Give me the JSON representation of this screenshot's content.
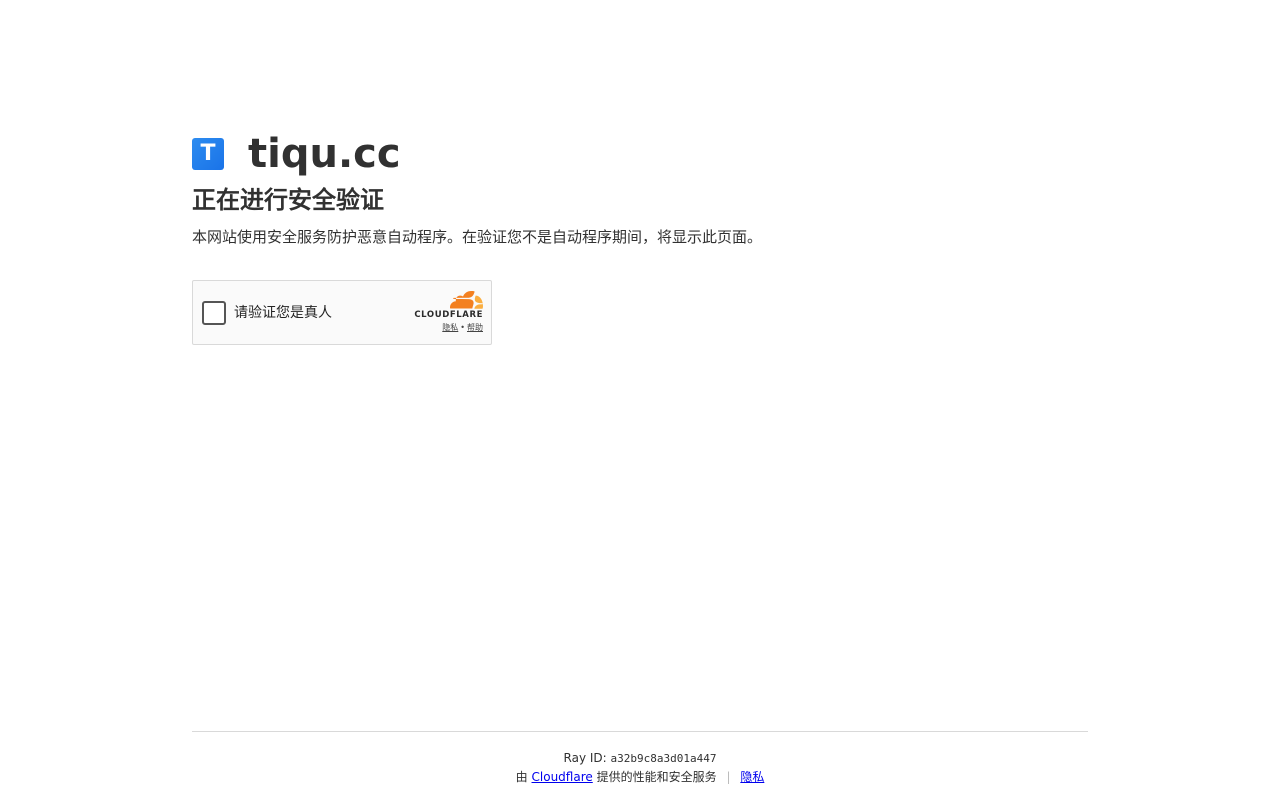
{
  "site": {
    "logo_letter": "T",
    "name": "tiqu.cc"
  },
  "challenge": {
    "heading": "正在进行安全验证",
    "description": "本网站使用安全服务防护恶意自动程序。在验证您不是自动程序期间，将显示此页面。"
  },
  "widget": {
    "checkbox_label": "请验证您是真人",
    "brand": "CLOUDFLARE",
    "privacy_link": "隐私",
    "separator": "•",
    "help_link": "帮助",
    "colors": {
      "cloud_orange": "#f38020",
      "cloud_light": "#faae40"
    }
  },
  "footer": {
    "ray_label": "Ray ID:",
    "ray_id": "a32b9c8a3d01a447",
    "by_prefix": "由",
    "cloudflare_link": "Cloudflare",
    "by_suffix": "提供的性能和安全服务",
    "separator": "|",
    "privacy_link": "隐私"
  }
}
